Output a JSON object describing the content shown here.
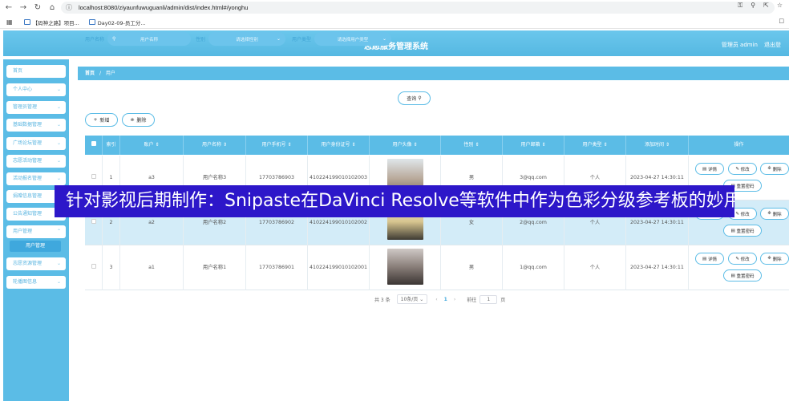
{
  "browser": {
    "url": "localhost:8080/ziyaunfuwuguanli/admin/dist/index.html#/yonghu",
    "bookmarks": [
      "【码神之路】项目...",
      "Day02-09-员工分..."
    ]
  },
  "header": {
    "title": "志愿服务管理系统",
    "user": "管理员 admin",
    "logout": "退出登"
  },
  "sidebar": {
    "items": [
      {
        "label": "首页",
        "chevron": false
      },
      {
        "label": "个人中心",
        "chevron": true
      },
      {
        "label": "管理员管理",
        "chevron": true
      },
      {
        "label": "基础数据管理",
        "chevron": true
      },
      {
        "label": "广场论坛管理",
        "chevron": true
      },
      {
        "label": "志愿活动管理",
        "chevron": true
      },
      {
        "label": "活动报名管理",
        "chevron": true
      },
      {
        "label": "捐赠信息管理",
        "chevron": true
      },
      {
        "label": "公告通知管理",
        "chevron": true
      },
      {
        "label": "用户管理",
        "chevron": true
      },
      {
        "label": "志愿资源管理",
        "chevron": true
      },
      {
        "label": "轮播图信息",
        "chevron": true
      }
    ],
    "sub_item": "用户管理"
  },
  "breadcrumb": {
    "home": "首页",
    "sep": "/",
    "current": "用户"
  },
  "filters": {
    "name_label": "用户名称",
    "name_placeholder": "用户名称",
    "gender_label": "性别",
    "gender_placeholder": "请选择性别",
    "type_label": "用户类型",
    "type_placeholder": "请选择用户类型",
    "search_btn": "查询"
  },
  "actions": {
    "add": "新增",
    "delete": "删除"
  },
  "table": {
    "columns": [
      "索引",
      "账户",
      "用户名称",
      "用户手机号",
      "用户身份证号",
      "用户头像",
      "性别",
      "用户邮箱",
      "用户类型",
      "添加时间",
      "操作"
    ],
    "rows": [
      {
        "index": "1",
        "account": "a3",
        "name": "用户名称3",
        "phone": "17703786903",
        "idcard": "410224199010102003",
        "gender": "男",
        "email": "3@qq.com",
        "type": "个人",
        "time": "2023-04-27 14:30:11"
      },
      {
        "index": "2",
        "account": "a2",
        "name": "用户名称2",
        "phone": "17703786902",
        "idcard": "410224199010102002",
        "gender": "女",
        "email": "2@qq.com",
        "type": "个人",
        "time": "2023-04-27 14:30:11"
      },
      {
        "index": "3",
        "account": "a1",
        "name": "用户名称1",
        "phone": "17703786901",
        "idcard": "410224199010102001",
        "gender": "男",
        "email": "1@qq.com",
        "type": "个人",
        "time": "2023-04-27 14:30:11"
      }
    ],
    "ops": {
      "detail": "详情",
      "edit": "修改",
      "delete": "删除",
      "reset": "重置密码"
    }
  },
  "pagination": {
    "total": "共 3 条",
    "size": "10条/页",
    "page": "1",
    "goto": "前往",
    "goto_value": "1",
    "unit": "页"
  },
  "overlay_banner": "针对影视后期制作：Snipaste在DaVinci Resolve等软件中作为色彩分级参考板的妙用"
}
